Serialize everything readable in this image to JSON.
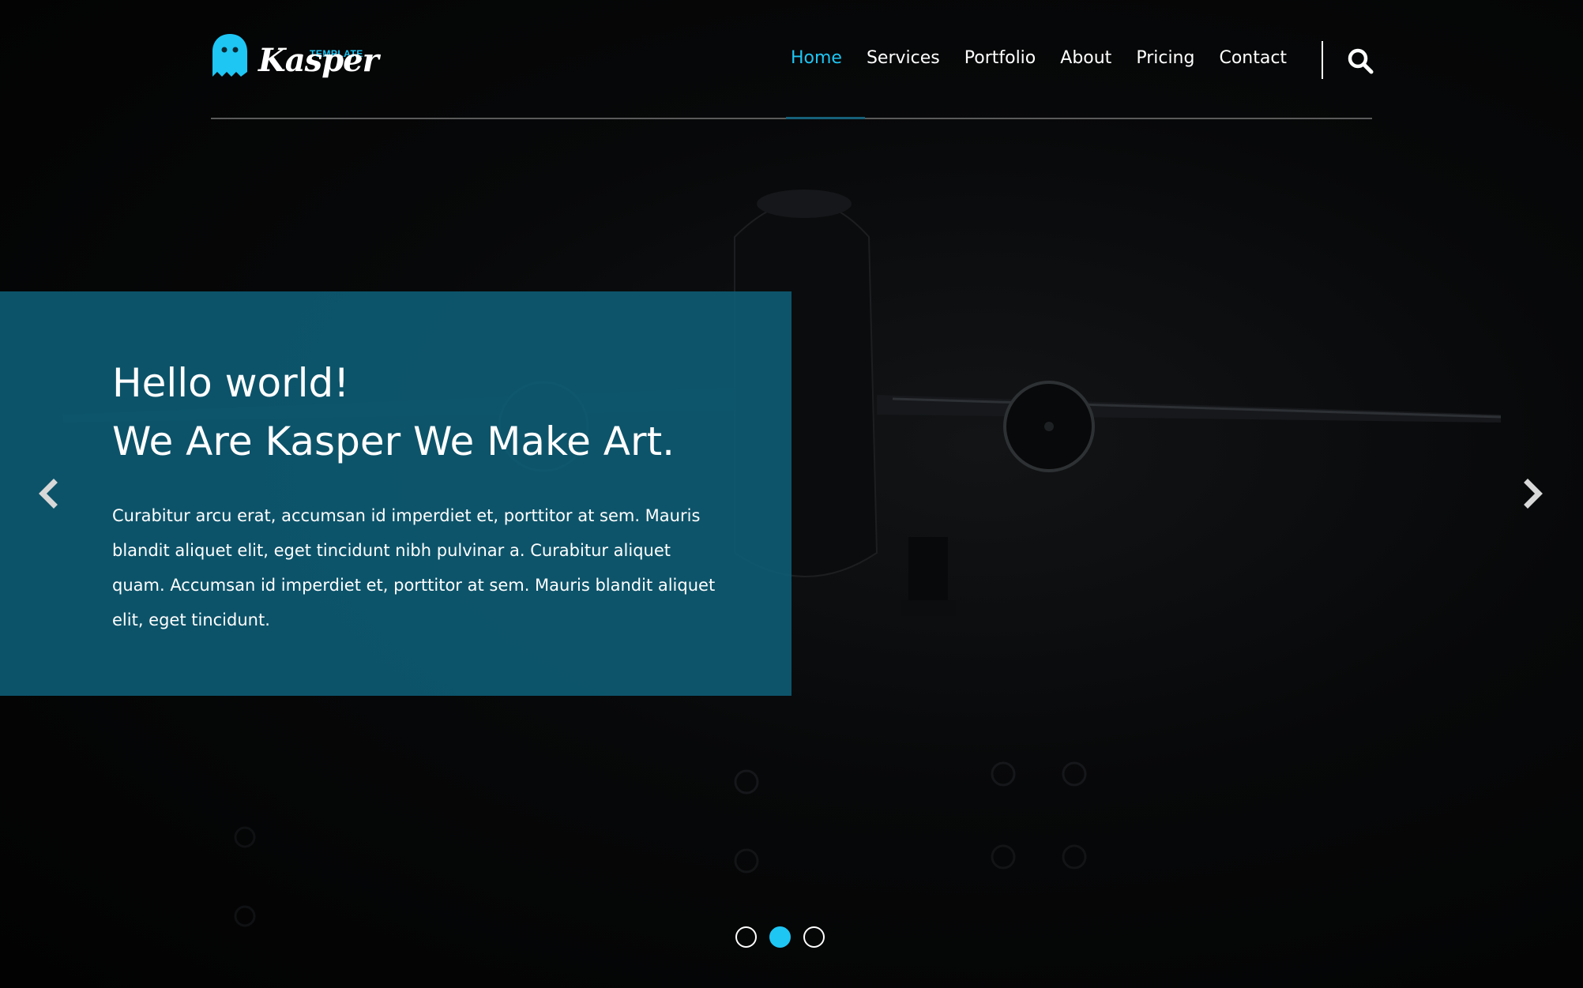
{
  "brand": {
    "name": "Kasper",
    "tagline": "TEMPLATE",
    "accent_color": "#1ec6f4",
    "logo_icon": "ghost-icon"
  },
  "nav": {
    "items": [
      {
        "label": "Home",
        "active": true
      },
      {
        "label": "Services",
        "active": false
      },
      {
        "label": "Portfolio",
        "active": false
      },
      {
        "label": "About",
        "active": false
      },
      {
        "label": "Pricing",
        "active": false
      },
      {
        "label": "Contact",
        "active": false
      }
    ],
    "search_icon": "search-icon"
  },
  "hero": {
    "heading_line1": "Hello world!",
    "heading_line2": "We Are Kasper We Make Art.",
    "paragraph": "Curabitur arcu erat, accumsan id imperdiet et, porttitor at sem. Mauris blandit aliquet elit, eget tincidunt nibh pulvinar a. Curabitur aliquet quam. Accumsan id imperdiet et, porttitor at sem. Mauris blandit aliquet elit, eget tincidunt.",
    "box_color": "#0e5f78",
    "prev_icon": "chevron-left-icon",
    "next_icon": "chevron-right-icon"
  },
  "slider": {
    "total_slides": 3,
    "active_slide": 2
  }
}
